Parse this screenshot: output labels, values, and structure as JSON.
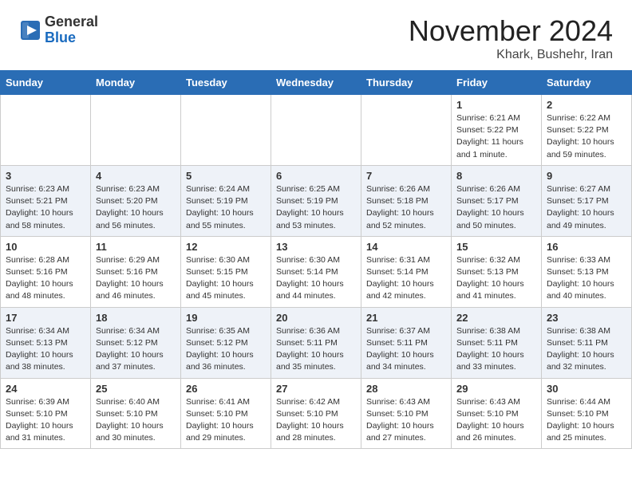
{
  "header": {
    "logo_general": "General",
    "logo_blue": "Blue",
    "month_title": "November 2024",
    "location": "Khark, Bushehr, Iran"
  },
  "calendar": {
    "days_of_week": [
      "Sunday",
      "Monday",
      "Tuesday",
      "Wednesday",
      "Thursday",
      "Friday",
      "Saturday"
    ],
    "weeks": [
      [
        {
          "day": "",
          "info": ""
        },
        {
          "day": "",
          "info": ""
        },
        {
          "day": "",
          "info": ""
        },
        {
          "day": "",
          "info": ""
        },
        {
          "day": "",
          "info": ""
        },
        {
          "day": "1",
          "info": "Sunrise: 6:21 AM\nSunset: 5:22 PM\nDaylight: 11 hours and 1 minute."
        },
        {
          "day": "2",
          "info": "Sunrise: 6:22 AM\nSunset: 5:22 PM\nDaylight: 10 hours and 59 minutes."
        }
      ],
      [
        {
          "day": "3",
          "info": "Sunrise: 6:23 AM\nSunset: 5:21 PM\nDaylight: 10 hours and 58 minutes."
        },
        {
          "day": "4",
          "info": "Sunrise: 6:23 AM\nSunset: 5:20 PM\nDaylight: 10 hours and 56 minutes."
        },
        {
          "day": "5",
          "info": "Sunrise: 6:24 AM\nSunset: 5:19 PM\nDaylight: 10 hours and 55 minutes."
        },
        {
          "day": "6",
          "info": "Sunrise: 6:25 AM\nSunset: 5:19 PM\nDaylight: 10 hours and 53 minutes."
        },
        {
          "day": "7",
          "info": "Sunrise: 6:26 AM\nSunset: 5:18 PM\nDaylight: 10 hours and 52 minutes."
        },
        {
          "day": "8",
          "info": "Sunrise: 6:26 AM\nSunset: 5:17 PM\nDaylight: 10 hours and 50 minutes."
        },
        {
          "day": "9",
          "info": "Sunrise: 6:27 AM\nSunset: 5:17 PM\nDaylight: 10 hours and 49 minutes."
        }
      ],
      [
        {
          "day": "10",
          "info": "Sunrise: 6:28 AM\nSunset: 5:16 PM\nDaylight: 10 hours and 48 minutes."
        },
        {
          "day": "11",
          "info": "Sunrise: 6:29 AM\nSunset: 5:16 PM\nDaylight: 10 hours and 46 minutes."
        },
        {
          "day": "12",
          "info": "Sunrise: 6:30 AM\nSunset: 5:15 PM\nDaylight: 10 hours and 45 minutes."
        },
        {
          "day": "13",
          "info": "Sunrise: 6:30 AM\nSunset: 5:14 PM\nDaylight: 10 hours and 44 minutes."
        },
        {
          "day": "14",
          "info": "Sunrise: 6:31 AM\nSunset: 5:14 PM\nDaylight: 10 hours and 42 minutes."
        },
        {
          "day": "15",
          "info": "Sunrise: 6:32 AM\nSunset: 5:13 PM\nDaylight: 10 hours and 41 minutes."
        },
        {
          "day": "16",
          "info": "Sunrise: 6:33 AM\nSunset: 5:13 PM\nDaylight: 10 hours and 40 minutes."
        }
      ],
      [
        {
          "day": "17",
          "info": "Sunrise: 6:34 AM\nSunset: 5:13 PM\nDaylight: 10 hours and 38 minutes."
        },
        {
          "day": "18",
          "info": "Sunrise: 6:34 AM\nSunset: 5:12 PM\nDaylight: 10 hours and 37 minutes."
        },
        {
          "day": "19",
          "info": "Sunrise: 6:35 AM\nSunset: 5:12 PM\nDaylight: 10 hours and 36 minutes."
        },
        {
          "day": "20",
          "info": "Sunrise: 6:36 AM\nSunset: 5:11 PM\nDaylight: 10 hours and 35 minutes."
        },
        {
          "day": "21",
          "info": "Sunrise: 6:37 AM\nSunset: 5:11 PM\nDaylight: 10 hours and 34 minutes."
        },
        {
          "day": "22",
          "info": "Sunrise: 6:38 AM\nSunset: 5:11 PM\nDaylight: 10 hours and 33 minutes."
        },
        {
          "day": "23",
          "info": "Sunrise: 6:38 AM\nSunset: 5:11 PM\nDaylight: 10 hours and 32 minutes."
        }
      ],
      [
        {
          "day": "24",
          "info": "Sunrise: 6:39 AM\nSunset: 5:10 PM\nDaylight: 10 hours and 31 minutes."
        },
        {
          "day": "25",
          "info": "Sunrise: 6:40 AM\nSunset: 5:10 PM\nDaylight: 10 hours and 30 minutes."
        },
        {
          "day": "26",
          "info": "Sunrise: 6:41 AM\nSunset: 5:10 PM\nDaylight: 10 hours and 29 minutes."
        },
        {
          "day": "27",
          "info": "Sunrise: 6:42 AM\nSunset: 5:10 PM\nDaylight: 10 hours and 28 minutes."
        },
        {
          "day": "28",
          "info": "Sunrise: 6:43 AM\nSunset: 5:10 PM\nDaylight: 10 hours and 27 minutes."
        },
        {
          "day": "29",
          "info": "Sunrise: 6:43 AM\nSunset: 5:10 PM\nDaylight: 10 hours and 26 minutes."
        },
        {
          "day": "30",
          "info": "Sunrise: 6:44 AM\nSunset: 5:10 PM\nDaylight: 10 hours and 25 minutes."
        }
      ]
    ]
  }
}
